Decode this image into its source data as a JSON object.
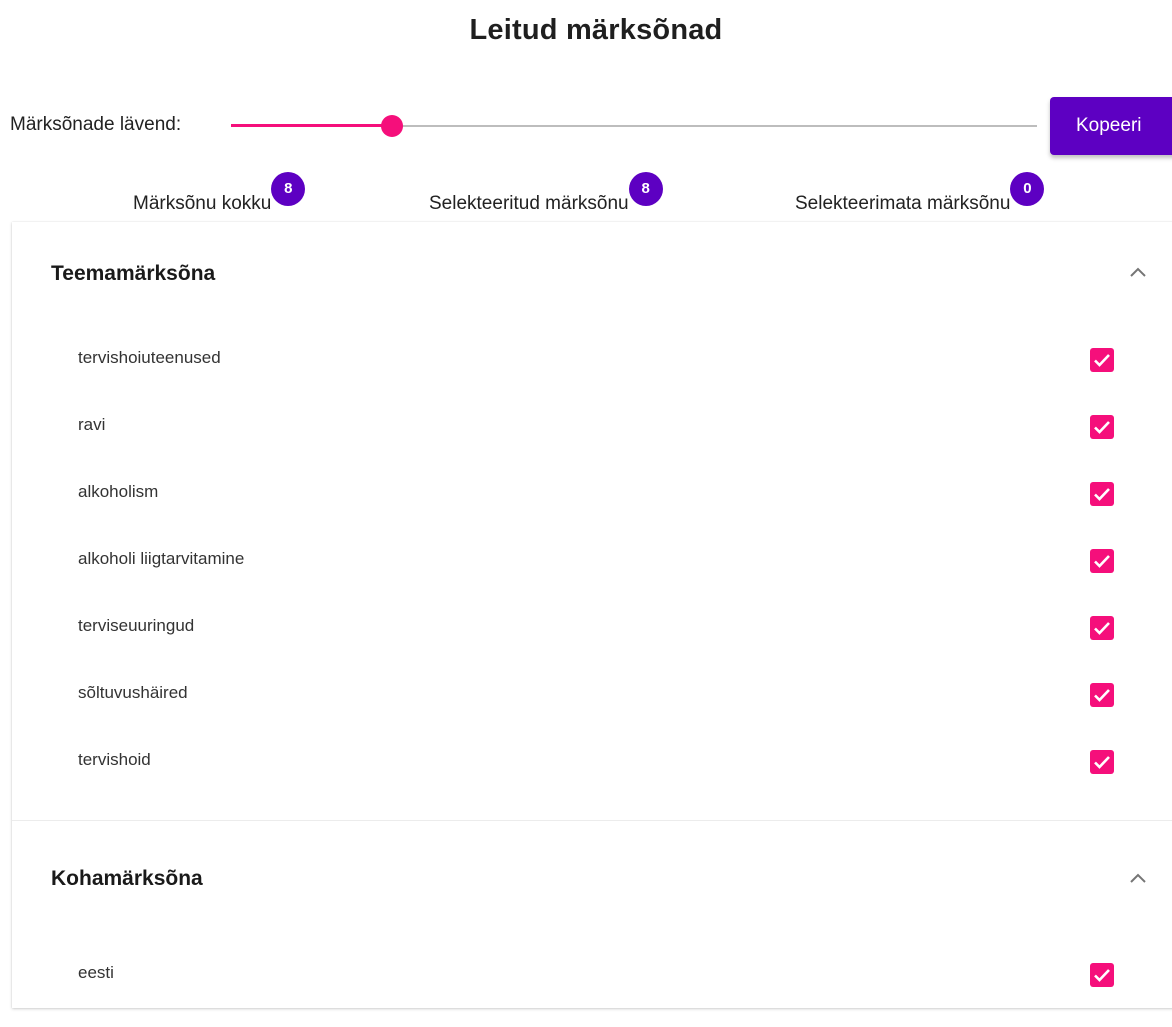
{
  "page": {
    "title": "Leitud märksõnad"
  },
  "threshold": {
    "label": "Märksõnade lävend:",
    "value_fraction": 0.2
  },
  "toolbar": {
    "copy_label": "Kopeeri"
  },
  "stats": {
    "total": {
      "label": "Märksõnu kokku",
      "count": "8"
    },
    "selected": {
      "label": "Selekteeritud märksõnu",
      "count": "8"
    },
    "unselected": {
      "label": "Selekteerimata märksõnu",
      "count": "0"
    }
  },
  "sections": [
    {
      "title": "Teemamärksõna",
      "expanded": true,
      "items": [
        {
          "label": "tervishoiuteenused",
          "checked": true
        },
        {
          "label": "ravi",
          "checked": true
        },
        {
          "label": "alkoholism",
          "checked": true
        },
        {
          "label": "alkoholi liigtarvitamine",
          "checked": true
        },
        {
          "label": "terviseuuringud",
          "checked": true
        },
        {
          "label": "sõltuvushäired",
          "checked": true
        },
        {
          "label": "tervishoid",
          "checked": true
        }
      ]
    },
    {
      "title": "Kohamärksõna",
      "expanded": true,
      "items": [
        {
          "label": "eesti",
          "checked": true
        }
      ]
    }
  ],
  "colors": {
    "accent": "#f50f7b",
    "primary": "#5d00c2",
    "track": "#bdbdbd"
  },
  "icons": {
    "chevron": "chevron-up-icon",
    "check": "check-icon"
  }
}
